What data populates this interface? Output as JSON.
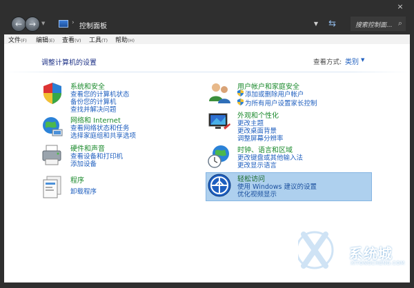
{
  "window": {
    "close_label": "×"
  },
  "nav": {
    "back_label": "←",
    "forward_label": "→",
    "dropdown_label": "▼",
    "address_separator": "›",
    "address_text": "控制面板",
    "address_dropdown": "▼",
    "refresh_label": "⇆",
    "search_placeholder": "搜索控制面...",
    "search_icon": "⌕"
  },
  "menu": {
    "items": [
      {
        "label": "文件",
        "accel": "(F)"
      },
      {
        "label": "编辑",
        "accel": "(E)"
      },
      {
        "label": "查看",
        "accel": "(V)"
      },
      {
        "label": "工具",
        "accel": "(T)"
      },
      {
        "label": "帮助",
        "accel": "(H)"
      }
    ]
  },
  "header": {
    "title": "调整计算机的设置",
    "view_by_label": "查看方式:",
    "view_by_value": "类别",
    "view_by_caret": "▼"
  },
  "categories": [
    {
      "icon": "shield-pc-icon",
      "title": "系统和安全",
      "links": [
        "查看您的计算机状态",
        "备份您的计算机",
        "查找并解决问题"
      ]
    },
    {
      "icon": "network-globe-icon",
      "title": "网络和 Internet",
      "links": [
        "查看网络状态和任务",
        "选择家庭组和共享选项"
      ]
    },
    {
      "icon": "printer-icon",
      "title": "硬件和声音",
      "links": [
        "查看设备和打印机",
        "添加设备"
      ]
    },
    {
      "icon": "programs-icon",
      "title": "程序",
      "links": [
        "卸载程序"
      ]
    },
    {
      "icon": "users-icon",
      "title": "用户帐户和家庭安全",
      "links": [
        "添加或删除用户帐户",
        "为所有用户设置家长控制"
      ]
    },
    {
      "icon": "display-icon",
      "title": "外观和个性化",
      "links": [
        "更改主题",
        "更改桌面背景",
        "调整屏幕分辨率"
      ]
    },
    {
      "icon": "clock-globe-icon",
      "title": "时钟、语言和区域",
      "links": [
        "更改键盘或其他输入法",
        "更改显示语言"
      ]
    },
    {
      "icon": "ease-of-access-icon",
      "title": "轻松访问",
      "links": [
        "使用 Windows 建议的设置",
        "优化视频显示"
      ],
      "highlighted": true
    }
  ],
  "watermark": {
    "brand": "系统城",
    "sub": "XITONGCHENG.COM"
  },
  "colors": {
    "title_green": "#1b8a2d",
    "link_blue": "#1f5fbf",
    "highlight": "#aed0ee",
    "chrome": "#2f2f2f"
  }
}
